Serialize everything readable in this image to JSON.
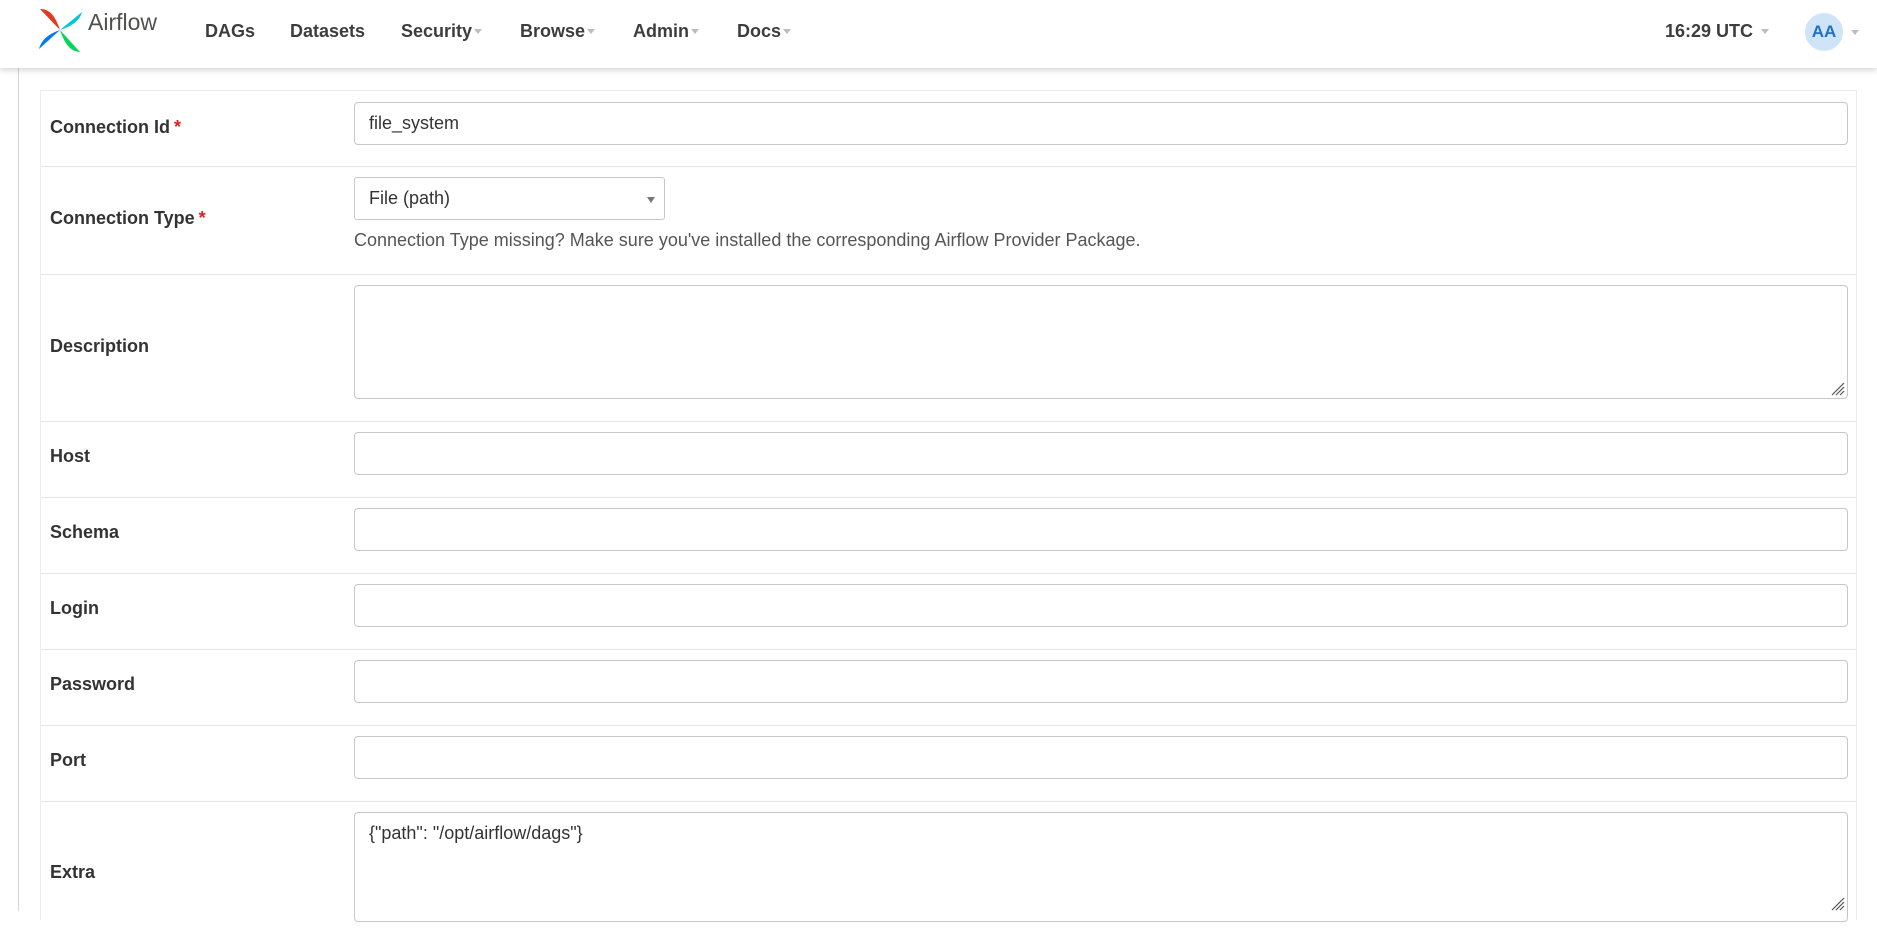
{
  "navbar": {
    "brand": "Airflow",
    "menu": [
      {
        "label": "DAGs",
        "has_dropdown": false
      },
      {
        "label": "Datasets",
        "has_dropdown": false
      },
      {
        "label": "Security",
        "has_dropdown": true
      },
      {
        "label": "Browse",
        "has_dropdown": true
      },
      {
        "label": "Admin",
        "has_dropdown": true
      },
      {
        "label": "Docs",
        "has_dropdown": true
      }
    ],
    "time": "16:29 UTC",
    "user_initials": "AA"
  },
  "form": {
    "conn_id": {
      "label": "Connection Id",
      "required_mark": "*",
      "value": "file_system"
    },
    "conn_type": {
      "label": "Connection Type",
      "required_mark": "*",
      "selected": "File (path)",
      "help": "Connection Type missing? Make sure you've installed the corresponding Airflow Provider Package."
    },
    "description": {
      "label": "Description",
      "value": ""
    },
    "host": {
      "label": "Host",
      "value": ""
    },
    "schema": {
      "label": "Schema",
      "value": ""
    },
    "login": {
      "label": "Login",
      "value": ""
    },
    "password": {
      "label": "Password",
      "value": ""
    },
    "port": {
      "label": "Port",
      "value": ""
    },
    "extra": {
      "label": "Extra",
      "value": "{\"path\": \"/opt/airflow/dags\"}"
    }
  },
  "colors": {
    "required": "#e02020",
    "avatar_bg": "#cfe4f7",
    "avatar_text": "#1a73c8",
    "logo_red": "#e43921",
    "logo_teal": "#00c7d4",
    "logo_blue": "#017cee",
    "logo_green": "#04d659"
  }
}
